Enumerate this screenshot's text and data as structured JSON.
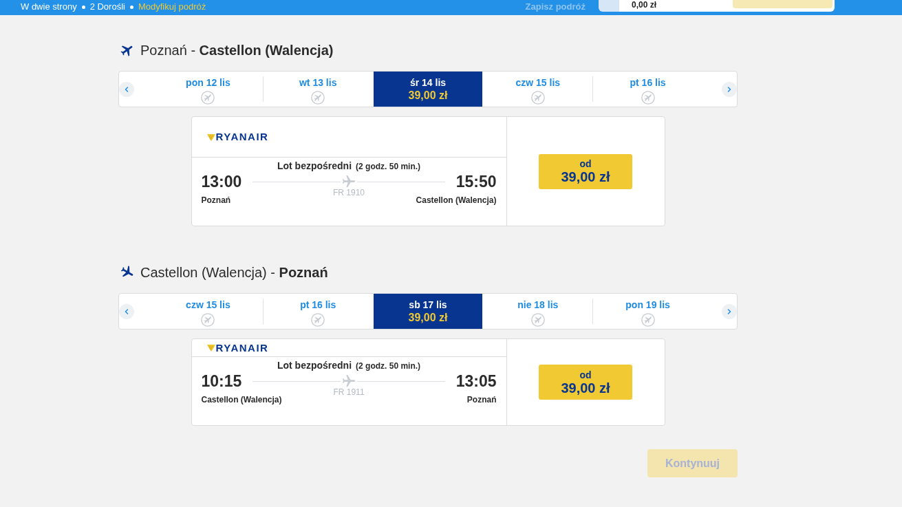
{
  "top_bar": {
    "trip_summary": [
      "W dwie strony",
      "2 Dorośli"
    ],
    "modify_link": "Modyfikuj podróż",
    "save_link": {
      "label": "Zapisz podróż",
      "disabled": true
    },
    "total_price": "0,00 zł"
  },
  "flights": [
    {
      "kind": "outbound",
      "title": "Poznań - **Castellon (Walencja)**",
      "dates": [
        {
          "label": "pon 12 lis",
          "selected": false,
          "kind": "no_flights"
        },
        {
          "label": "wt 13 lis",
          "selected": false,
          "kind": "no_flights"
        },
        {
          "label": "śr 14 lis",
          "selected": true,
          "kind": "fare",
          "price": "39,00 zł"
        },
        {
          "label": "czw 15 lis",
          "selected": false,
          "kind": "no_flights"
        },
        {
          "label": "pt 16 lis",
          "selected": false,
          "kind": "no_flights"
        }
      ],
      "card": {
        "airline": "RYANAIR",
        "route_type": "Lot bezpośredni",
        "duration": "(2 godz. 50 min.)",
        "departure": {
          "time": "13:00",
          "city": "Poznań"
        },
        "arrival": {
          "time": "15:50",
          "city": "Castellon (Walencja)"
        },
        "flight_number": "FR 1910",
        "price_label": "od",
        "price": "39,00 zł"
      }
    },
    {
      "kind": "inbound",
      "title": "Castellon (Walencja) - **Poznań**",
      "dates": [
        {
          "label": "czw 15 lis",
          "selected": false,
          "kind": "no_flights"
        },
        {
          "label": "pt 16 lis",
          "selected": false,
          "kind": "no_flights"
        },
        {
          "label": "sb 17 lis",
          "selected": true,
          "kind": "fare",
          "price": "39,00 zł"
        },
        {
          "label": "nie 18 lis",
          "selected": false,
          "kind": "no_flights"
        },
        {
          "label": "pon 19 lis",
          "selected": false,
          "kind": "no_flights"
        }
      ],
      "card": {
        "airline": "RYANAIR",
        "route_type": "Lot bezpośredni",
        "duration": "(2 godz. 50 min.)",
        "departure": {
          "time": "10:15",
          "city": "Castellon (Walencja)"
        },
        "arrival": {
          "time": "13:05",
          "city": "Poznań"
        },
        "flight_number": "FR 1911",
        "price_label": "od",
        "price": "39,00 zł"
      }
    }
  ],
  "continue_button": {
    "label": "Kontynuuj",
    "disabled": true
  }
}
